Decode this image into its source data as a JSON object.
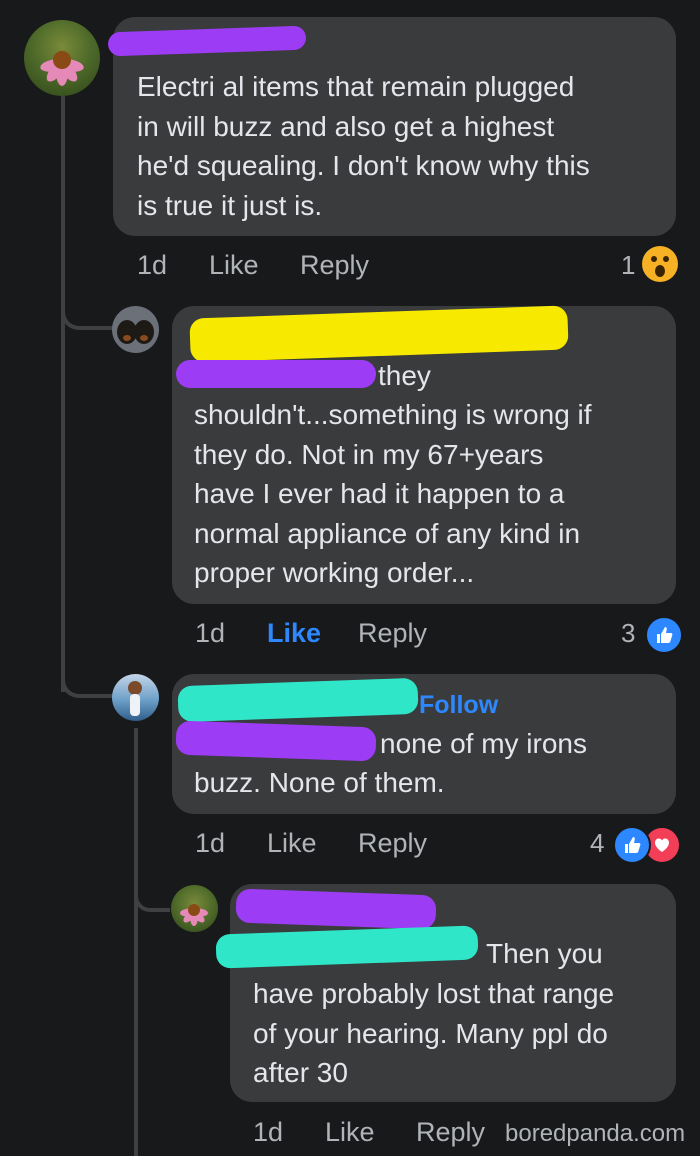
{
  "comments": [
    {
      "text": "Electri al items that remain plugged\nin will buzz and also get a highest\nhe'd squealing. I don't know why this\nis true it just is.",
      "time": "1d",
      "like_label": "Like",
      "reply_label": "Reply",
      "reaction_count": "1",
      "reactions": [
        "wow-icon"
      ]
    },
    {
      "text_first": "they",
      "text": "shouldn't...something is wrong if\nthey do.  Not in my 67+years\nhave I ever had it happen to a\nnormal appliance of any kind in\nproper working order...",
      "time": "1d",
      "like_label": "Like",
      "reply_label": "Reply",
      "reaction_count": "3",
      "reactions": [
        "like-icon"
      ]
    },
    {
      "follow_label": "Follow",
      "text_first": "none of my irons",
      "text": "buzz. None of them.",
      "time": "1d",
      "like_label": "Like",
      "reply_label": "Reply",
      "reaction_count": "4",
      "reactions": [
        "like-icon",
        "love-icon"
      ]
    },
    {
      "text_first": "Then you",
      "text": "have probably lost that range\nof your hearing. Many ppl do\nafter 30",
      "time": "1d",
      "like_label": "Like",
      "reply_label": "Reply"
    }
  ],
  "colors": {
    "scribble_purple": "#9d3cf5",
    "scribble_yellow": "#f7ea00",
    "scribble_cyan": "#2fe6c8",
    "like_blue": "#2d88ff",
    "love_red": "#f33e58",
    "wow_yellow": "#f7b125"
  },
  "watermark": "boredpanda.com"
}
